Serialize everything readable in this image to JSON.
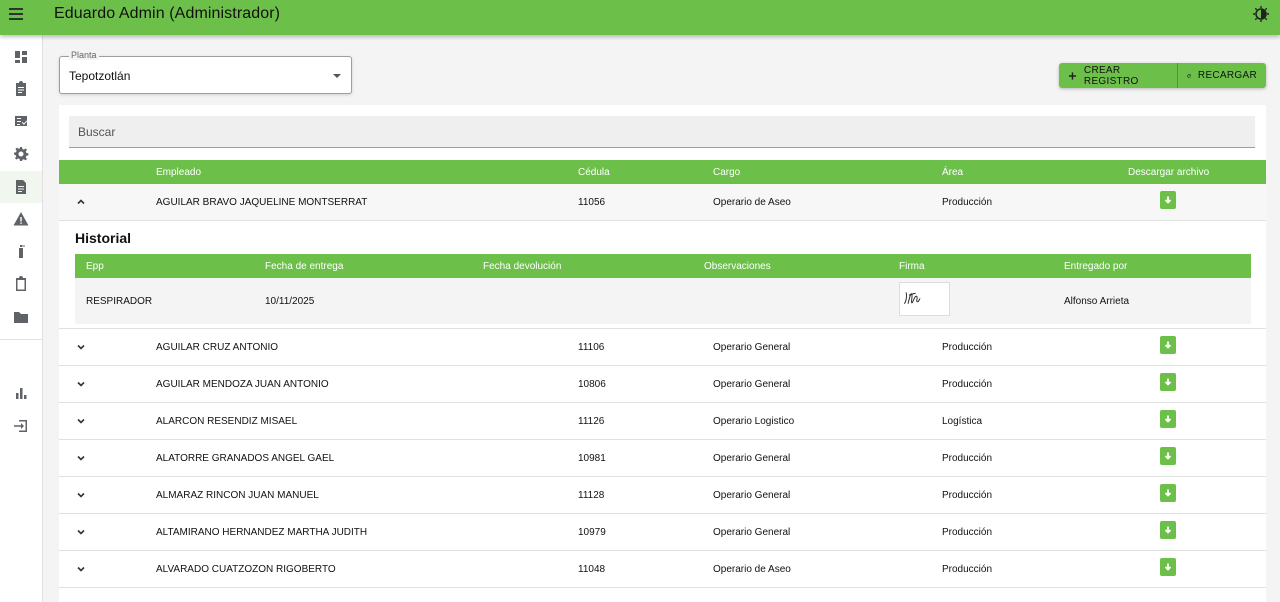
{
  "header": {
    "title": "Eduardo Admin (Administrador)"
  },
  "filter": {
    "label": "Planta",
    "value": "Tepotzotlán"
  },
  "actions": {
    "create_label": "CREAR REGISTRO",
    "reload_label": "RECARGAR"
  },
  "search": {
    "placeholder": "Buscar"
  },
  "table": {
    "columns": [
      "Empleado",
      "Cédula",
      "Cargo",
      "Área",
      "Descargar archivo"
    ],
    "rows": [
      [
        "AGUILAR BRAVO JAQUELINE MONTSERRAT",
        "11056",
        "Operario de Aseo",
        "Producción"
      ],
      [
        "AGUILAR CRUZ ANTONIO",
        "11106",
        "Operario General",
        "Producción"
      ],
      [
        "AGUILAR MENDOZA JUAN ANTONIO",
        "10806",
        "Operario General",
        "Producción"
      ],
      [
        "ALARCON RESENDIZ MISAEL",
        "11126",
        "Operario Logistico",
        "Logística"
      ],
      [
        "ALATORRE GRANADOS ANGEL GAEL",
        "10981",
        "Operario General",
        "Producción"
      ],
      [
        "ALMARAZ RINCON JUAN MANUEL",
        "11128",
        "Operario General",
        "Producción"
      ],
      [
        "ALTAMIRANO HERNANDEZ MARTHA JUDITH",
        "10979",
        "Operario General",
        "Producción"
      ],
      [
        "ALVARADO CUATZOZON RIGOBERTO",
        "11048",
        "Operario de Aseo",
        "Producción"
      ]
    ]
  },
  "history": {
    "title": "Historial",
    "columns": [
      "Epp",
      "Fecha de entrega",
      "Fecha devolución",
      "Observaciones",
      "Firma",
      "Entregado por"
    ],
    "row": {
      "epp": "RESPIRADOR",
      "fecha_entrega": "10/11/2025",
      "fecha_devolucion": "",
      "observaciones": "",
      "entregado_por": "Alfonso Arrieta"
    }
  },
  "icons": {
    "topbar": [
      "menu-icon",
      "theme-toggle-icon"
    ],
    "sidebar": [
      "dashboard-icon",
      "assignment-icon",
      "checklist-icon",
      "settings-icon",
      "document-icon",
      "warning-icon",
      "fire-extinguisher-icon",
      "clipboard-icon",
      "folder-icon",
      "bar-chart-icon",
      "logout-icon"
    ]
  },
  "colors": {
    "accent": "#6cc04a",
    "header_text": "#ffffff"
  }
}
